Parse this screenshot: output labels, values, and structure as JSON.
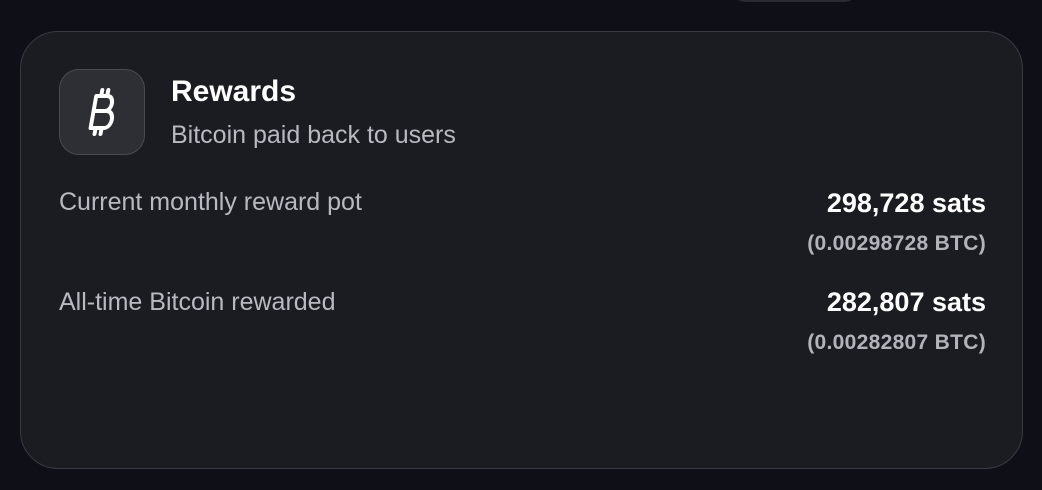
{
  "rewards": {
    "icon": "bitcoin-icon",
    "title": "Rewards",
    "subtitle": "Bitcoin paid back to users",
    "rows": [
      {
        "label": "Current monthly reward pot",
        "value": "298,728 sats",
        "btc": "(0.00298728 BTC)"
      },
      {
        "label": "All-time Bitcoin rewarded",
        "value": "282,807 sats",
        "btc": "(0.00282807 BTC)"
      }
    ]
  }
}
